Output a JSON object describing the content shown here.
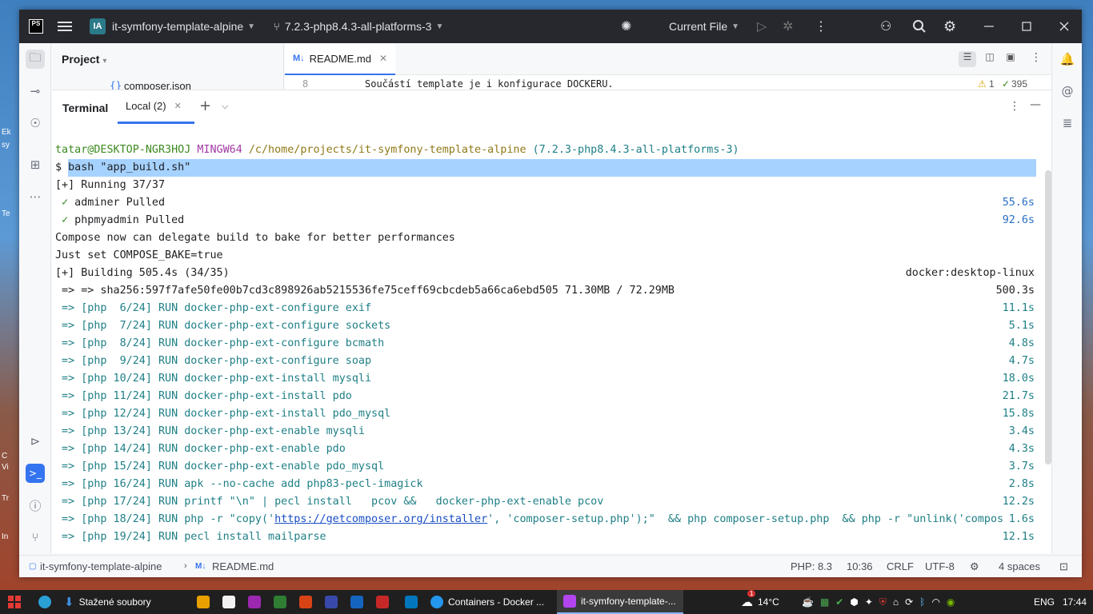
{
  "desktop": {
    "labels": [
      "Ek",
      "sy",
      "Te",
      "C",
      "Vi",
      "Tr",
      "In"
    ]
  },
  "titlebar": {
    "logo_text": "PS",
    "project_badge": "IA",
    "project_name": "it-symfony-template-alpine",
    "branch": "7.2.3-php8.4.3-all-platforms-3",
    "run_config": "Current File",
    "icons": [
      "hamburger-icon",
      "branch-icon",
      "debug-bug-icon",
      "run-icon",
      "debug-icon",
      "more-icon",
      "add-user-icon",
      "search-icon",
      "settings-gear-icon",
      "minimize-icon",
      "maximize-icon",
      "close-icon"
    ]
  },
  "project_panel": {
    "title": "Project",
    "file": "composer.json",
    "file_icon_text": "{}"
  },
  "editor": {
    "tab_label": "README.md",
    "tab_icon_text": "M↓",
    "line_number": "8",
    "line_text": "Součástí template je i konfigurace DOCKERU.",
    "warnings": "1",
    "checks": "395"
  },
  "terminal": {
    "title": "Terminal",
    "tab_label": "Local (2)",
    "prompt": {
      "user_host": "tatar@DESKTOP-NGR3HOJ",
      "shell": "MINGW64",
      "path": "/c/home/projects/it-symfony-template-alpine",
      "branch": "(7.2.3-php8.4.3-all-platforms-3)"
    },
    "command_prefix": "$ ",
    "command": "bash \"app_build.sh\"",
    "lines": [
      {
        "text": "[+] Running 37/37",
        "right": "",
        "style": "dark"
      },
      {
        "check": "✓",
        "text": " adminer Pulled",
        "right": "55.6s",
        "style": "dark"
      },
      {
        "check": "✓",
        "text": " phpmyadmin Pulled",
        "right": "92.6s",
        "style": "dark"
      },
      {
        "text": "Compose now can delegate build to bake for better performances",
        "right": "",
        "style": "dark"
      },
      {
        "text": "Just set COMPOSE_BAKE=true",
        "right": "",
        "style": "dark"
      },
      {
        "text": "[+] Building 505.4s (34/35)",
        "right": "docker:desktop-linux",
        "style": "dark"
      },
      {
        "text": " => => sha256:597f7afe50fe00b7cd3c898926ab5215536fe75ceff69cbcdeb5a66ca6ebd505 71.30MB / 72.29MB",
        "right": "500.3s",
        "style": "dark"
      },
      {
        "text": " => [php  6/24] RUN docker-php-ext-configure exif",
        "right": "11.1s",
        "style": "cyan"
      },
      {
        "text": " => [php  7/24] RUN docker-php-ext-configure sockets",
        "right": "5.1s",
        "style": "cyan"
      },
      {
        "text": " => [php  8/24] RUN docker-php-ext-configure bcmath",
        "right": "4.8s",
        "style": "cyan"
      },
      {
        "text": " => [php  9/24] RUN docker-php-ext-configure soap",
        "right": "4.7s",
        "style": "cyan"
      },
      {
        "text": " => [php 10/24] RUN docker-php-ext-install mysqli",
        "right": "18.0s",
        "style": "cyan"
      },
      {
        "text": " => [php 11/24] RUN docker-php-ext-install pdo",
        "right": "21.7s",
        "style": "cyan"
      },
      {
        "text": " => [php 12/24] RUN docker-php-ext-install pdo_mysql",
        "right": "15.8s",
        "style": "cyan"
      },
      {
        "text": " => [php 13/24] RUN docker-php-ext-enable mysqli",
        "right": "3.4s",
        "style": "cyan"
      },
      {
        "text": " => [php 14/24] RUN docker-php-ext-enable pdo",
        "right": "4.3s",
        "style": "cyan"
      },
      {
        "text": " => [php 15/24] RUN docker-php-ext-enable pdo_mysql",
        "right": "3.7s",
        "style": "cyan"
      },
      {
        "text": " => [php 16/24] RUN apk --no-cache add php83-pecl-imagick",
        "right": "2.8s",
        "style": "cyan"
      },
      {
        "text": " => [php 17/24] RUN printf \"\\n\" | pecl install   pcov &&   docker-php-ext-enable pcov",
        "right": "12.2s",
        "style": "cyan"
      }
    ],
    "line18": {
      "before": " => [php 18/24] RUN php -r \"copy('",
      "link": "https://getcomposer.org/installer",
      "after": "', 'composer-setup.php');\"  && php composer-setup.php  && php -r \"unlink('compos",
      "right": "1.6s"
    },
    "line19": {
      "text": " => [php 19/24] RUN pecl install mailparse",
      "right": "12.1s"
    }
  },
  "statusbar": {
    "project": "it-symfony-template-alpine",
    "file": "README.md",
    "php": "PHP: 8.3",
    "position": "10:36",
    "line_ending": "CRLF",
    "encoding": "UTF-8",
    "indent": "4 spaces"
  },
  "taskbar": {
    "downloads": "Stažené soubory",
    "docker": "Containers - Docker ...",
    "ide": "it-symfony-template-...",
    "weather": "14°C",
    "weather_badge": "1",
    "language": "ENG",
    "time": "17:44"
  },
  "colors": {
    "accent": "#3574f0",
    "titlebar": "#27282e",
    "terminal_cyan": "#1e7f86",
    "selection": "#a6d2ff"
  }
}
